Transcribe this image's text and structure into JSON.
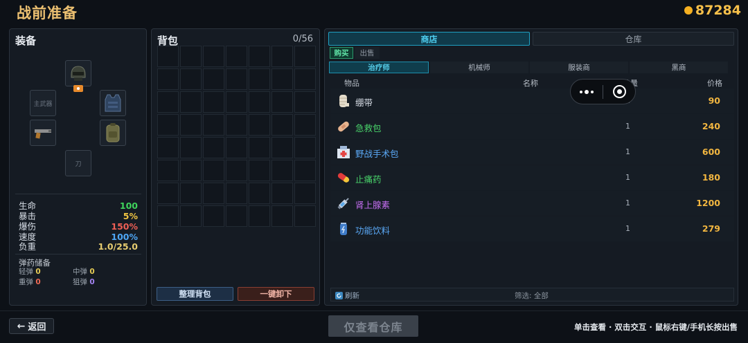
{
  "header": {
    "title": "战前准备",
    "coins": "87284",
    "coin_icon": "gold-coin-icon"
  },
  "equipment": {
    "title": "装备",
    "slots": {
      "primary_weapon": "主武器",
      "knife": "刀"
    },
    "stats": [
      {
        "label": "生命",
        "value": "100",
        "color": "#3fd45c"
      },
      {
        "label": "暴击",
        "value": "5%",
        "color": "#f0c542"
      },
      {
        "label": "爆伤",
        "value": "150%",
        "color": "#ef5f55"
      },
      {
        "label": "速度",
        "value": "100%",
        "color": "#4ea6f5"
      },
      {
        "label": "负重",
        "value": "1.0/25.0",
        "color": "#e6cc70"
      }
    ],
    "ammo": {
      "title": "弹药储备",
      "items": [
        {
          "label": "轻弹",
          "value": "0",
          "color": "#e6cc55"
        },
        {
          "label": "中弹",
          "value": "0",
          "color": "#e6cc55"
        },
        {
          "label": "重弹",
          "value": "0",
          "color": "#ef6a55"
        },
        {
          "label": "狙弹",
          "value": "0",
          "color": "#a384f2"
        }
      ]
    }
  },
  "backpack": {
    "title": "背包",
    "capacity": "0/56",
    "sort_label": "整理背包",
    "unload_label": "一键卸下"
  },
  "shop": {
    "tabs": [
      "商店",
      "仓库"
    ],
    "subtabs": [
      "购买",
      "出售"
    ],
    "categories": [
      "治疗师",
      "机械师",
      "服装商",
      "黑商"
    ],
    "columns": {
      "item": "物品",
      "name": "名称",
      "qty": "数量",
      "price": "价格"
    },
    "items": [
      {
        "name": "绷带",
        "qty": "1",
        "price": "90",
        "color": "#d7dde6",
        "icon": "bandage-icon"
      },
      {
        "name": "急救包",
        "qty": "1",
        "price": "240",
        "color": "#49d36a",
        "icon": "first-aid-icon"
      },
      {
        "name": "野战手术包",
        "qty": "1",
        "price": "600",
        "color": "#5aa8f5",
        "icon": "surgery-kit-icon"
      },
      {
        "name": "止痛药",
        "qty": "1",
        "price": "180",
        "color": "#49d36a",
        "icon": "pill-icon"
      },
      {
        "name": "肾上腺素",
        "qty": "1",
        "price": "1200",
        "color": "#c46ef0",
        "icon": "syringe-icon"
      },
      {
        "name": "功能饮料",
        "qty": "1",
        "price": "279",
        "color": "#5aa8f5",
        "icon": "energy-drink-icon"
      }
    ],
    "refresh_label": "刷新",
    "filter_label": "筛选: 全部"
  },
  "footer": {
    "back_label": "返回",
    "view_only_label": "仅查看仓库",
    "hint": "单击查看 · 双击交互 · 鼠标右键/手机长按出售"
  }
}
